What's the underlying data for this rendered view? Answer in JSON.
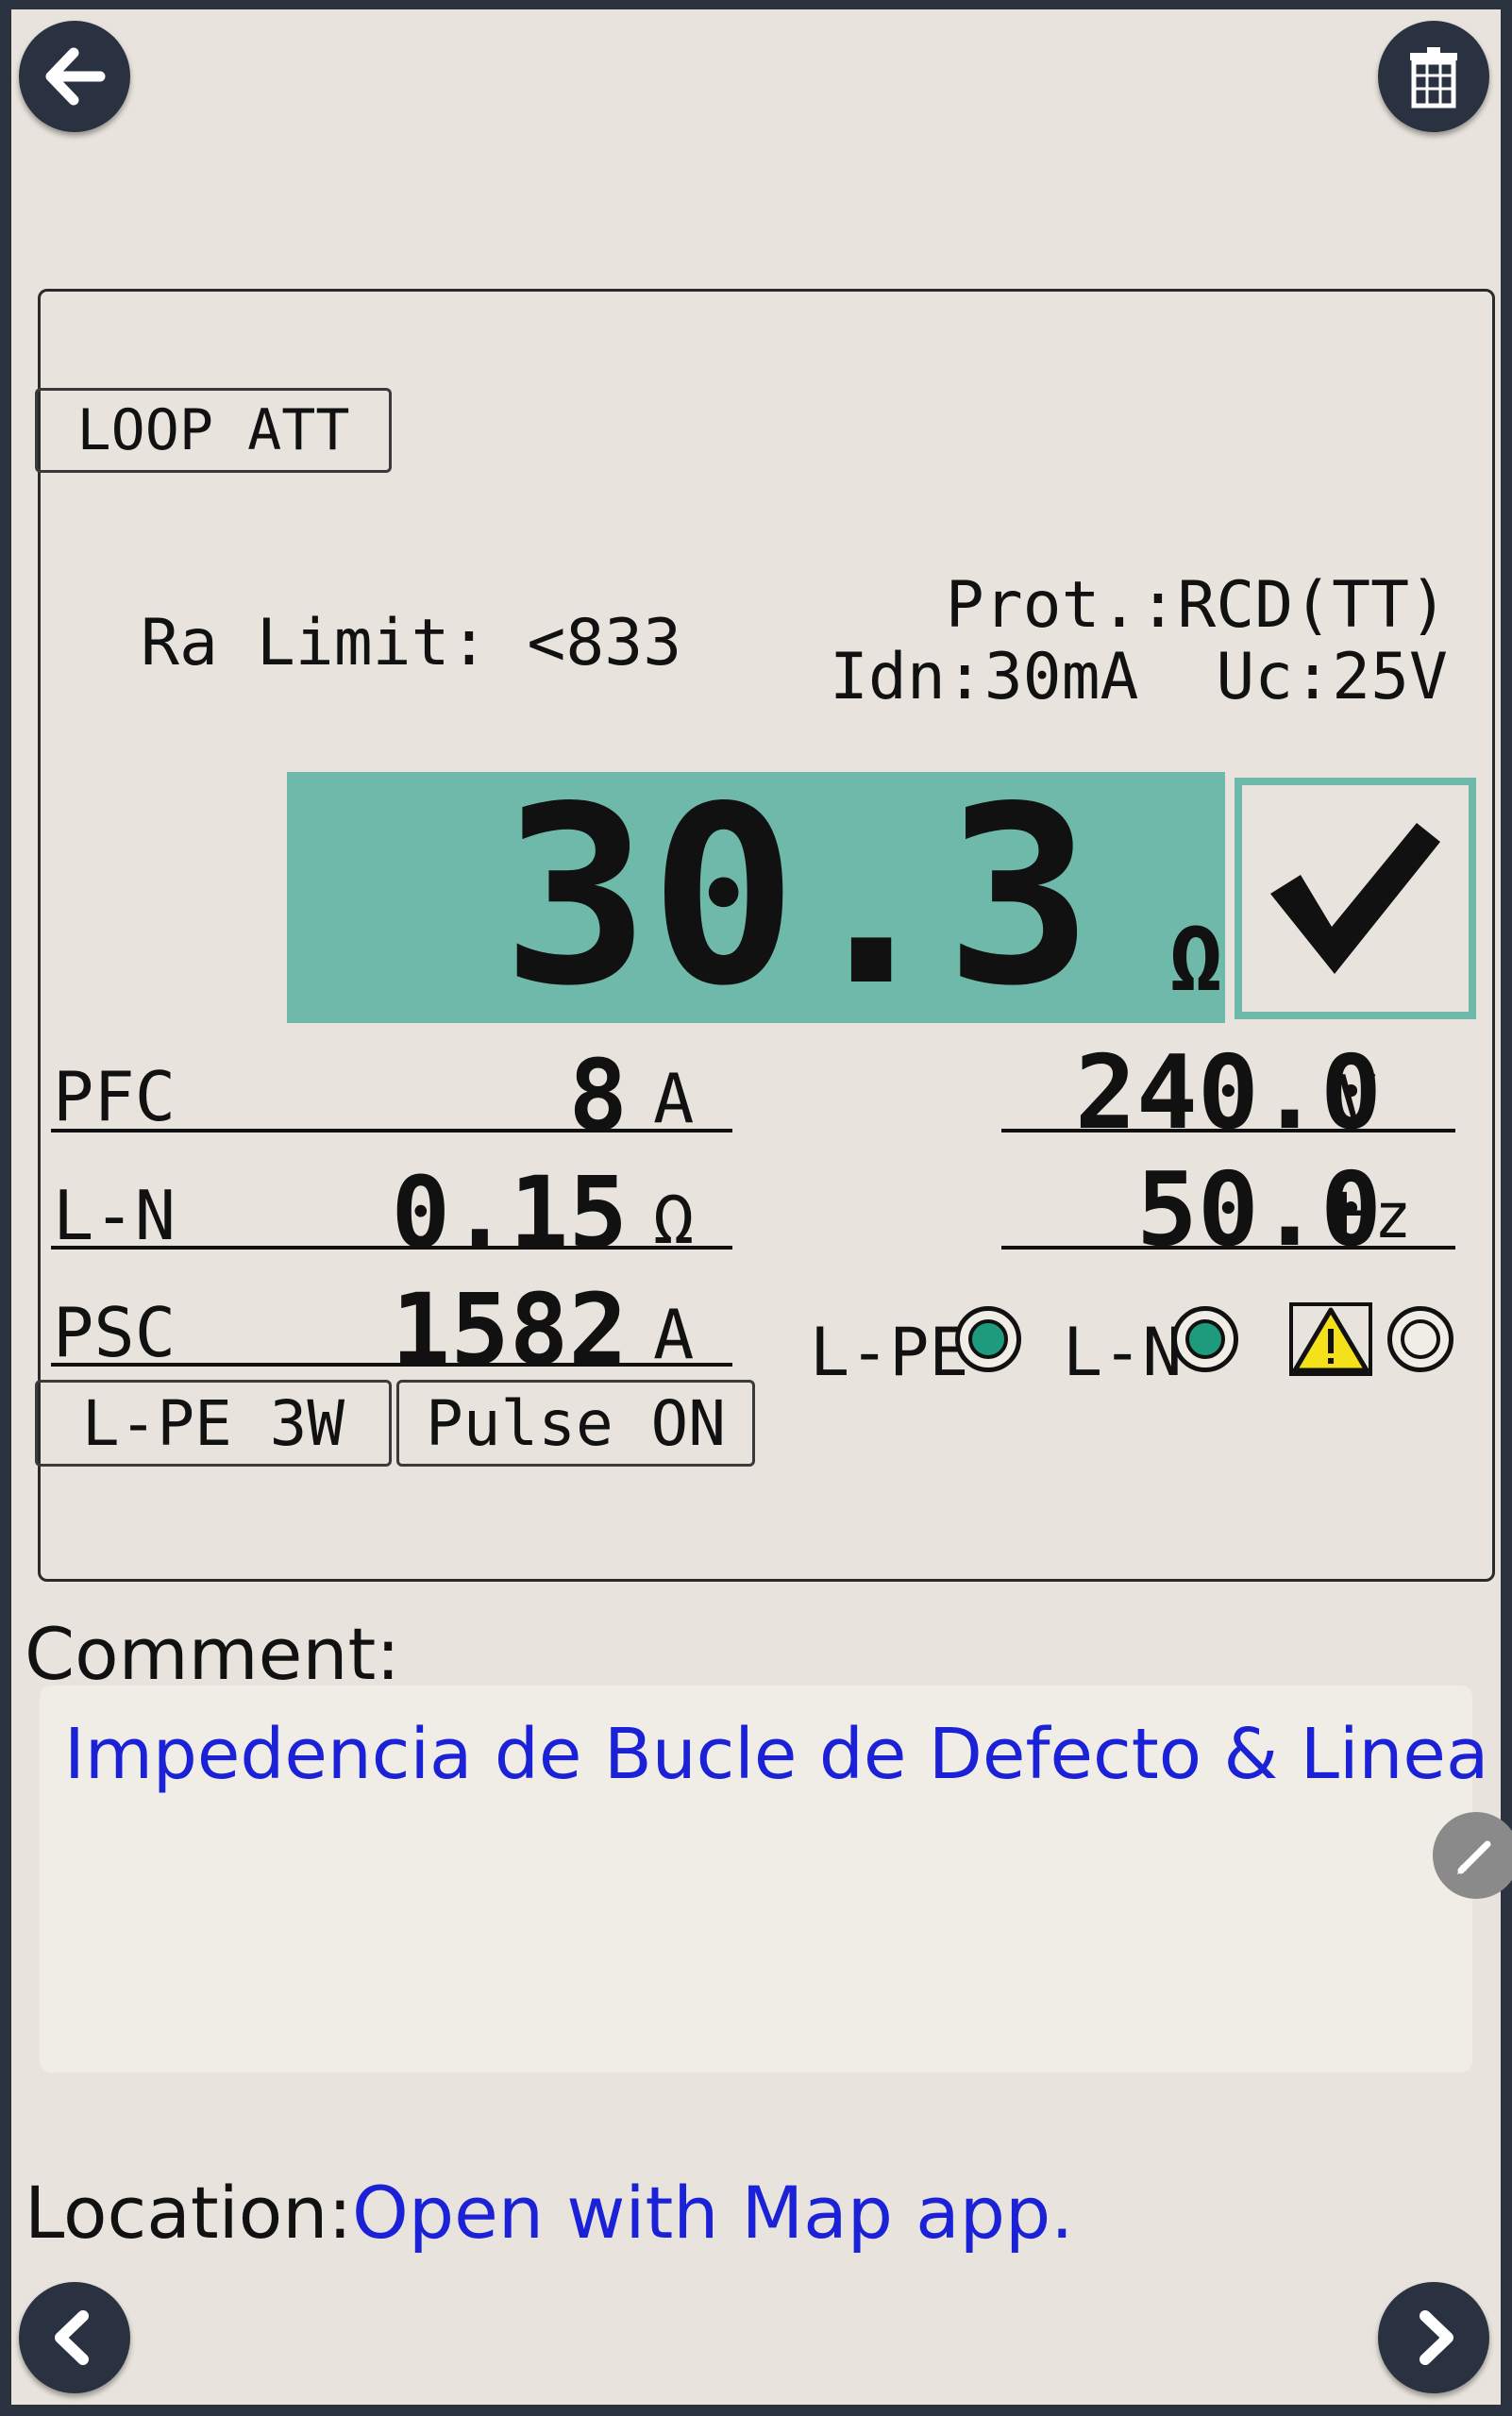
{
  "nav": {
    "back_icon": "arrow-left-icon",
    "delete_icon": "trash-icon",
    "prev_icon": "chevron-left-icon",
    "next_icon": "chevron-right-icon"
  },
  "meter": {
    "mode_button": "LOOP ATT",
    "ra_limit": "Ra Limit: <833",
    "protection": "Prot.:RCD(TT)",
    "idn_uc": "Idn:30mA  Uc:25V",
    "main_value": "30.3",
    "main_unit": "Ω",
    "result_icon": "checkmark-icon",
    "rows": [
      {
        "label": "PFC",
        "value": "8",
        "unit": "A"
      },
      {
        "label": "L-N",
        "value": "0.15",
        "unit": "Ω"
      },
      {
        "label": "PSC",
        "value": "1582",
        "unit": "A"
      }
    ],
    "voltage": {
      "value": "240.0",
      "unit": "V"
    },
    "frequency": {
      "value": "50.0",
      "unit": "Hz"
    },
    "indicators": {
      "lpe": "L-PE",
      "ln": "L-N",
      "warning_icon": "warning-icon"
    },
    "wiring_button": "L-PE 3W",
    "pulse_button": "Pulse ON",
    "display_color": "#6fb9ab"
  },
  "comment": {
    "label": "Comment:",
    "text": "Impedencia de Bucle de Defecto & Linea",
    "edit_icon": "pencil-icon"
  },
  "location": {
    "label": "Location:",
    "link": "Open with Map app."
  }
}
